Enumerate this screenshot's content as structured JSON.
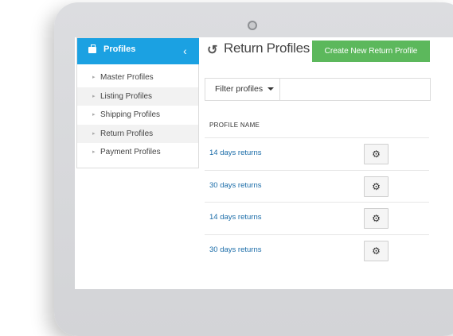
{
  "sidebar": {
    "title": "Profiles",
    "collapse_icon": "chevron-left-icon",
    "items": [
      {
        "label": "Master Profiles"
      },
      {
        "label": "Listing Profiles"
      },
      {
        "label": "Shipping Profiles"
      },
      {
        "label": "Return Profiles"
      },
      {
        "label": "Payment Profiles"
      }
    ]
  },
  "header": {
    "title": "Return Profiles",
    "icon": "refresh-icon",
    "create_label": "Create New Return Profile"
  },
  "filter": {
    "label": "Filter profiles"
  },
  "table": {
    "column_header": "PROFILE NAME",
    "rows": [
      {
        "name": "14 days returns"
      },
      {
        "name": "30 days returns"
      },
      {
        "name": "14 days returns"
      },
      {
        "name": "30 days returns"
      }
    ]
  },
  "colors": {
    "accent": "#1ba1e2",
    "button_green": "#5cb85c",
    "link": "#1a6ca8"
  }
}
